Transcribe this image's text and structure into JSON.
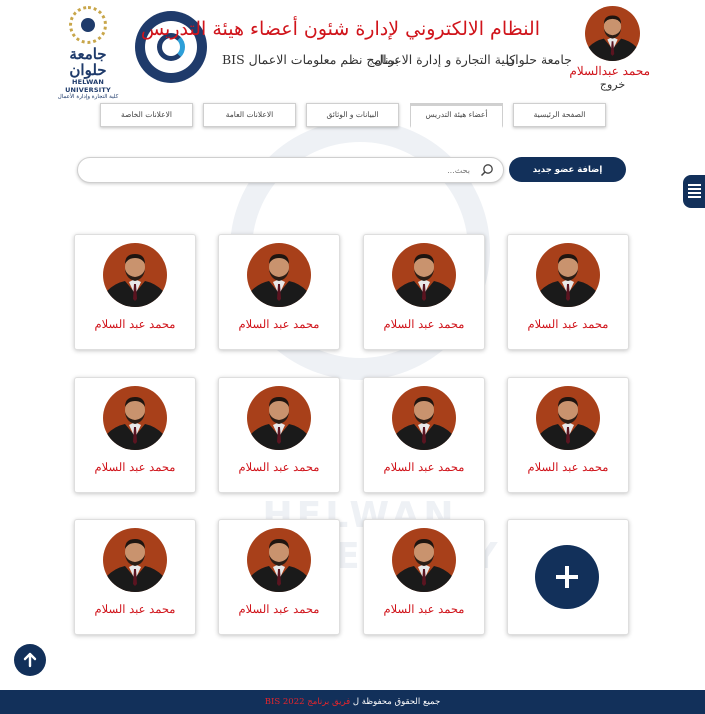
{
  "header": {
    "title": "النظام الالكتروني لإدارة شئون أعضاء هيئة التدريس",
    "nav": [
      "جامعة حلوان",
      "كلية التجارة و إدارة الاعمال",
      "برنامج نظم معلومات الاعمال BIS"
    ],
    "helwan_logo_ar": "جامعة حلوان",
    "helwan_logo_en": "HELWAN UNIVERSITY",
    "helwan_logo_sub": "كلية التجارة وإدارة الأعمال",
    "user_name": "محمد عبدالسلام",
    "logout": "خروج"
  },
  "tabs": [
    {
      "label": "الصفحة الرئيسية"
    },
    {
      "label": "أعضاء هيئة التدريس",
      "active": true
    },
    {
      "label": "البيانات و الوثائق"
    },
    {
      "label": "الاعلانات العامة"
    },
    {
      "label": "الاعلانات الخاصة"
    }
  ],
  "search": {
    "placeholder": "بحث..."
  },
  "add_button": "إضافة عضو جديد",
  "members": [
    {
      "name": "محمد عبد السلام"
    },
    {
      "name": "محمد عبد السلام"
    },
    {
      "name": "محمد عبد السلام"
    },
    {
      "name": "محمد عبد السلام"
    },
    {
      "name": "محمد عبد السلام"
    },
    {
      "name": "محمد عبد السلام"
    },
    {
      "name": "محمد عبد السلام"
    },
    {
      "name": "محمد عبد السلام"
    },
    {
      "name": "محمد عبد السلام"
    },
    {
      "name": "محمد عبد السلام"
    },
    {
      "name": "محمد عبد السلام"
    }
  ],
  "watermark_text": "HELWAN UNIVERSITY",
  "footer": {
    "text": "جميع الحقوق محفوظة ل",
    "highlight": "فريق برنامج BIS 2022"
  },
  "colors": {
    "primary": "#12305a",
    "accent_red": "#d0141b"
  }
}
